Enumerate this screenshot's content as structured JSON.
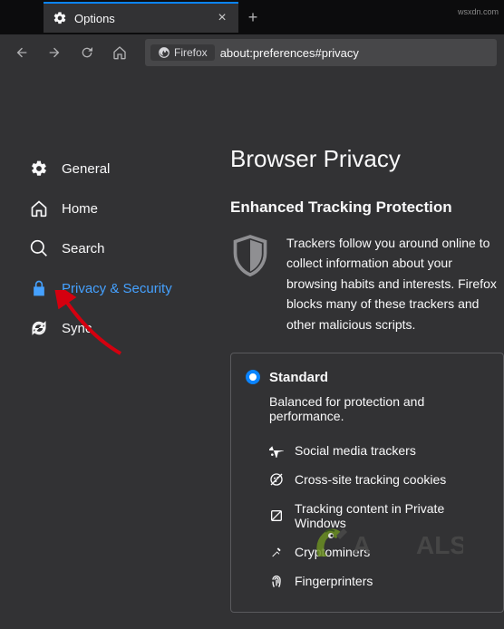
{
  "tab": {
    "title": "Options"
  },
  "urlbar": {
    "identity": "Firefox",
    "url": "about:preferences#privacy"
  },
  "sidebar": {
    "items": [
      {
        "label": "General"
      },
      {
        "label": "Home"
      },
      {
        "label": "Search"
      },
      {
        "label": "Privacy & Security"
      },
      {
        "label": "Sync"
      }
    ]
  },
  "content": {
    "page_title": "Browser Privacy",
    "section_title": "Enhanced Tracking Protection",
    "description": "Trackers follow you around online to collect information about your browsing habits and interests. Firefox blocks many of these trackers and other malicious scripts.",
    "protection": {
      "option_label": "Standard",
      "option_desc": "Balanced for protection and performance.",
      "items": [
        "Social media trackers",
        "Cross-site tracking cookies",
        "Tracking content in Private Windows",
        "Cryptominers",
        "Fingerprinters"
      ]
    }
  },
  "watermark": "wsxdn.com"
}
